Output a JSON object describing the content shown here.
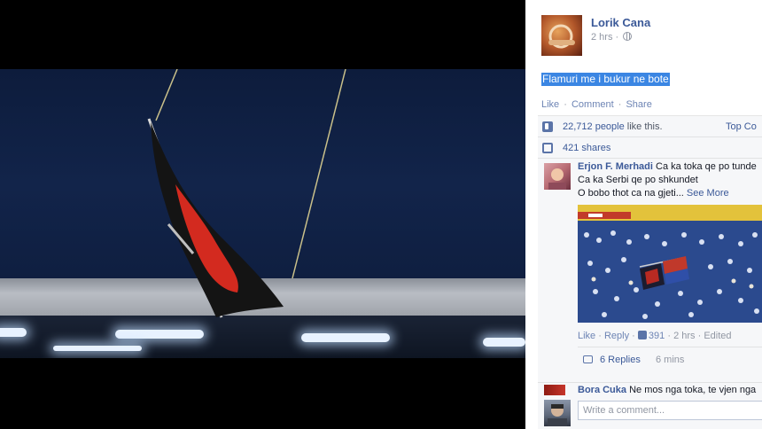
{
  "post": {
    "author": "Lorik Cana",
    "time": "2 hrs",
    "text": "Flamuri me i bukur ne bote",
    "actions": {
      "like": "Like",
      "comment": "Comment",
      "share": "Share"
    }
  },
  "ufi": {
    "like_count": "22,712 people",
    "like_tail": "like this.",
    "top_comments": "Top Co",
    "shares": "421 shares"
  },
  "comments": [
    {
      "name": "Erjon F. Merhadi",
      "line1": "Ca ka toka qe po tunde",
      "line2": "Ca ka Serbi qe po shkundet",
      "line3": "O bobo thot ca na gjeti...",
      "see_more": "See More",
      "like": "Like",
      "reply": "Reply",
      "likes": "391",
      "time": "2 hrs",
      "edited": "Edited",
      "replies": "6 Replies",
      "replies_time": "6 mins"
    },
    {
      "name": "Bora Cuka",
      "text": "Ne mos nga toka, te vjen nga"
    }
  ],
  "composer": {
    "placeholder": "Write a comment..."
  },
  "icons": [
    "globe-icon",
    "like-thumb-icon",
    "share-icon",
    "reply-icon"
  ],
  "colors": {
    "link": "#3b5998",
    "highlight": "#3b86e3",
    "panel_bg": "#f6f7f9"
  }
}
